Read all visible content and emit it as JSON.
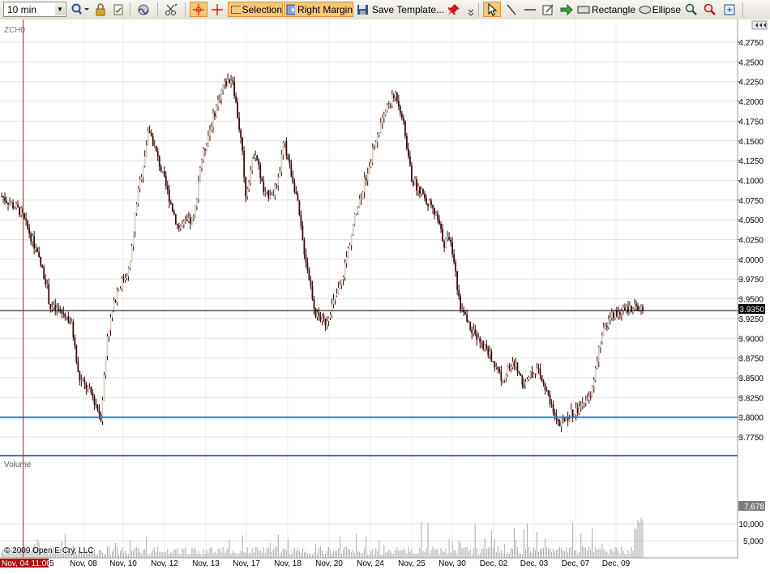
{
  "toolbar": {
    "interval": "10 min",
    "selection_label": "Selection",
    "right_margin_label": "Right Margin",
    "save_template_label": "Save Template...",
    "rectangle_label": "Rectangle",
    "ellipse_label": "Ellipse"
  },
  "chart": {
    "symbol": "ZCH0",
    "volume_label": "Volume",
    "copyright": "© 2009 Open E Cry, LLC",
    "current_price_label": "3.9350",
    "current_volume_label": "7,678",
    "cursor_time_label": "Nov, 04 11:00",
    "cursor_partial_suffix": "5",
    "price_ticks": [
      "4.2750",
      "4.2500",
      "4.2250",
      "4.2000",
      "4.1750",
      "4.1500",
      "4.1250",
      "4.1000",
      "4.0750",
      "4.0500",
      "4.0250",
      "4.0000",
      "3.9750",
      "3.9500",
      "3.9250",
      "3.9000",
      "3.8750",
      "3.8500",
      "3.8250",
      "3.8000",
      "3.7750"
    ],
    "volume_ticks": [
      "10,000",
      "5,000"
    ],
    "date_labels": [
      "Nov, 08",
      "Nov, 10",
      "Nov, 12",
      "Nov, 13",
      "Nov, 17",
      "Nov, 18",
      "Nov, 20",
      "Nov, 24",
      "Nov, 25",
      "Nov, 30",
      "Dec, 02",
      "Dec, 03",
      "Dec, 07",
      "Dec, 09"
    ],
    "horizontal_lines": [
      {
        "price": 3.935,
        "color": "#000000"
      },
      {
        "price": 3.8,
        "color": "#1f7fd0"
      }
    ]
  },
  "chart_data": {
    "type": "candlestick",
    "title": "ZCH0",
    "ylim": [
      3.76,
      4.285
    ],
    "volume_ylim": [
      0,
      13000
    ],
    "price_path_x": [
      0,
      0.03,
      0.05,
      0.07,
      0.075,
      0.1,
      0.11,
      0.12,
      0.14,
      0.155,
      0.165,
      0.18,
      0.2,
      0.21,
      0.23,
      0.25,
      0.275,
      0.3,
      0.31,
      0.33,
      0.345,
      0.36,
      0.375,
      0.38,
      0.395,
      0.41,
      0.43,
      0.44,
      0.46,
      0.47,
      0.49,
      0.505,
      0.53,
      0.55,
      0.58,
      0.6,
      0.615,
      0.625,
      0.64,
      0.66,
      0.68,
      0.69,
      0.7,
      0.715,
      0.73,
      0.76,
      0.78,
      0.8,
      0.815,
      0.82,
      0.835,
      0.85,
      0.865,
      0.87,
      0.88,
      0.9,
      0.92,
      0.935,
      0.95,
      0.97,
      0.985,
      1.0
    ],
    "price_path_y": [
      4.08,
      4.06,
      4.02,
      3.97,
      3.94,
      3.93,
      3.915,
      3.85,
      3.83,
      3.8,
      3.905,
      3.96,
      3.99,
      4.07,
      4.165,
      4.11,
      4.04,
      4.05,
      4.12,
      4.18,
      4.22,
      4.23,
      4.14,
      4.08,
      4.14,
      4.08,
      4.09,
      4.15,
      4.08,
      4.02,
      3.93,
      3.92,
      3.97,
      4.05,
      4.14,
      4.19,
      4.21,
      4.18,
      4.1,
      4.08,
      4.05,
      4.02,
      4.03,
      3.94,
      3.915,
      3.88,
      3.85,
      3.87,
      3.84,
      3.85,
      3.86,
      3.83,
      3.8,
      3.79,
      3.8,
      3.81,
      3.83,
      3.9,
      3.93,
      3.935,
      3.94,
      3.935
    ],
    "volume_level": "mostly 1,000-3,500 with spikes near 10,000-11,000 late in the period"
  }
}
